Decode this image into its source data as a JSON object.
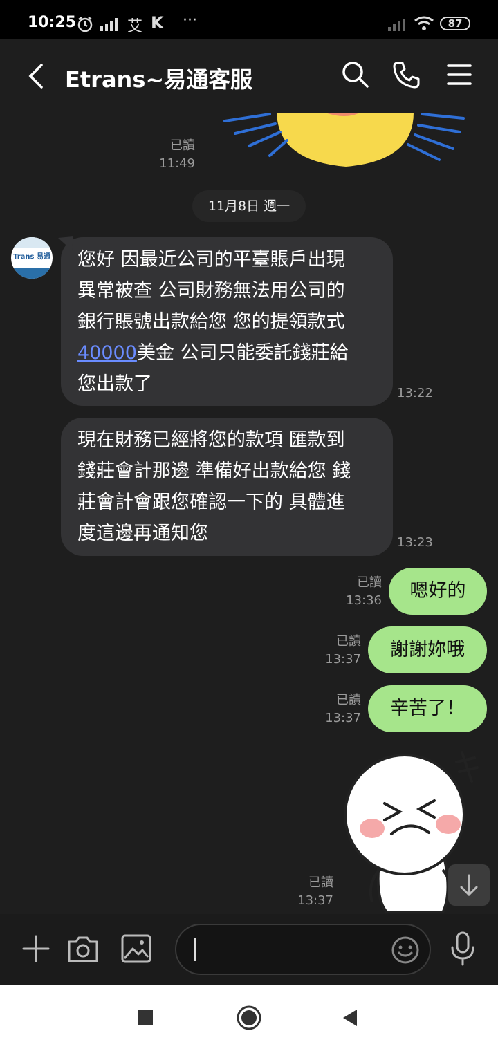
{
  "status_bar": {
    "time": "10:25",
    "carrier_icon_text": "艾",
    "k_icon_text": "K",
    "more_dots": "···",
    "battery": "87"
  },
  "header": {
    "title": "Etrans~易通客服",
    "back_icon": "chevron-left-icon",
    "search_icon": "search-icon",
    "phone_icon": "phone-icon",
    "menu_icon": "menu-icon"
  },
  "chat": {
    "first_receipt": {
      "read": "已讀",
      "time": "11:49"
    },
    "date_chip": "11月8日 週一",
    "avatar_text": "Trans 易通",
    "incoming": [
      {
        "lines": [
          "您好 因最近公司的平臺賬戶出現",
          "異常被查 公司財務無法用公司的",
          "銀行賬號出款給您 您的提領款式"
        ],
        "link": "40000",
        "after_link": "美金 公司只能委託錢莊給",
        "last_line": "您出款了",
        "time": "13:22"
      },
      {
        "lines": [
          "現在財務已經將您的款項 匯款到",
          "錢莊會計那邊 準備好出款給您 錢",
          "莊會計會跟您確認一下的 具體進",
          "度這邊再通知您"
        ],
        "time": "13:23"
      }
    ],
    "outgoing": [
      {
        "text": "嗯好的",
        "read": "已讀",
        "time": "13:36"
      },
      {
        "text": "謝謝妳哦",
        "read": "已讀",
        "time": "13:37"
      },
      {
        "text": "辛苦了！",
        "read": "已讀",
        "time": "13:37"
      }
    ],
    "sticker_receipt": {
      "read": "已讀",
      "time": "13:37"
    }
  },
  "composer": {
    "plus_icon": "plus-icon",
    "camera_icon": "camera-icon",
    "image_icon": "image-icon",
    "emoji_icon": "emoji-icon",
    "mic_icon": "microphone-icon",
    "input_value": ""
  },
  "colors": {
    "background": "#1e1e1e",
    "incoming_bubble": "#333335",
    "outgoing_bubble": "#a6e58b",
    "link": "#6a8cff"
  }
}
